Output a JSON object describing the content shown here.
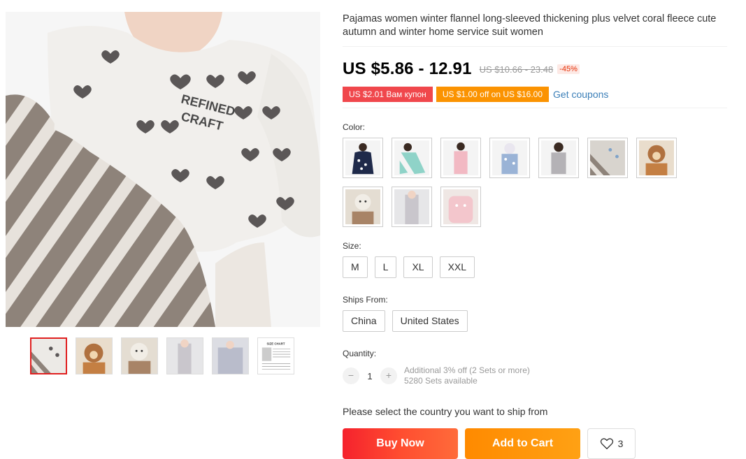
{
  "product": {
    "title": "Pajamas women winter flannel long-sleeved thickening plus velvet coral fleece cute autumn and winter home service suit women",
    "price": "US $5.86 - 12.91",
    "original_price": "US $10.66 - 23.48",
    "discount": "-45%"
  },
  "coupons": {
    "coupon1": "US $2.01 Вам купон",
    "coupon2": "US $1.00 off on US $16.00",
    "get_coupons": "Get coupons"
  },
  "color": {
    "label": "Color:"
  },
  "size": {
    "label": "Size:",
    "options": [
      "M",
      "L",
      "XL",
      "XXL"
    ]
  },
  "ships_from": {
    "label": "Ships From:",
    "options": [
      "China",
      "United States"
    ]
  },
  "quantity": {
    "label": "Quantity:",
    "minus": "−",
    "value": "1",
    "plus": "+",
    "additional": "Additional 3% off (2 Sets or more)",
    "available": "5280 Sets available"
  },
  "ship_note": "Please select the country you want to ship from",
  "actions": {
    "buy_now": "Buy Now",
    "add_to_cart": "Add to Cart",
    "wishlist_count": "3"
  },
  "main_image": {
    "print_line1": "REFINED",
    "print_line2": "CRAFT"
  },
  "thumbnails": {
    "size_chart_label": "SIZE CHART"
  },
  "colors": {
    "accent_red": "#f0474c",
    "accent_orange": "#fb9301",
    "link_blue": "#3b7fb8"
  }
}
